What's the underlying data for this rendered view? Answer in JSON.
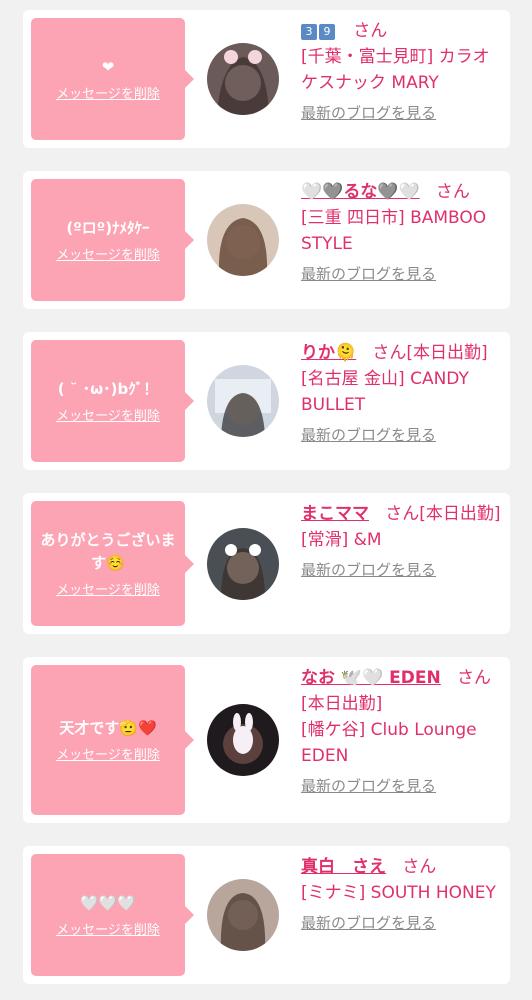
{
  "delete_label": "メッセージを削除",
  "blog_label": "最新のブログを見る",
  "san_label": "さん",
  "cards": [
    {
      "message": "❤",
      "name": "",
      "name_prefix": [
        "3",
        "9"
      ],
      "status": "",
      "shop_prefix": "[千葉・富士見町]",
      "shop": "カラオケスナック MARY",
      "extra_line": ""
    },
    {
      "message": "(ºロº)ﾅﾒﾀｹｰ",
      "name": "🤍🩶るな🩶🤍",
      "status": "",
      "shop_prefix": "[三重 四日市]",
      "shop": "BAMBOO STYLE",
      "extra_line": ""
    },
    {
      "message": "( ˘ ･ω･)bｸﾞ！",
      "name": "りか🫠",
      "status": "[本日出勤]",
      "shop_prefix": "[名古屋 金山]",
      "shop": "CANDY BULLET",
      "extra_line": ""
    },
    {
      "message": "ありがとうございます☺️",
      "name": "まこママ",
      "status": "[本日出勤]",
      "shop_prefix": "[常滑]",
      "shop": "&M",
      "extra_line": ""
    },
    {
      "message": "天才です🫡❤️",
      "name": "なお 🕊️🤍 EDEN",
      "status": "[本日出勤]",
      "shop_prefix": "[幡ケ谷]",
      "shop": "Club Lounge EDEN",
      "extra_line": ""
    },
    {
      "message": "🤍🤍🤍",
      "name": "真白　さえ",
      "status": "",
      "shop_prefix": "[ミナミ]",
      "shop": "SOUTH HONEY",
      "extra_line": ""
    }
  ]
}
